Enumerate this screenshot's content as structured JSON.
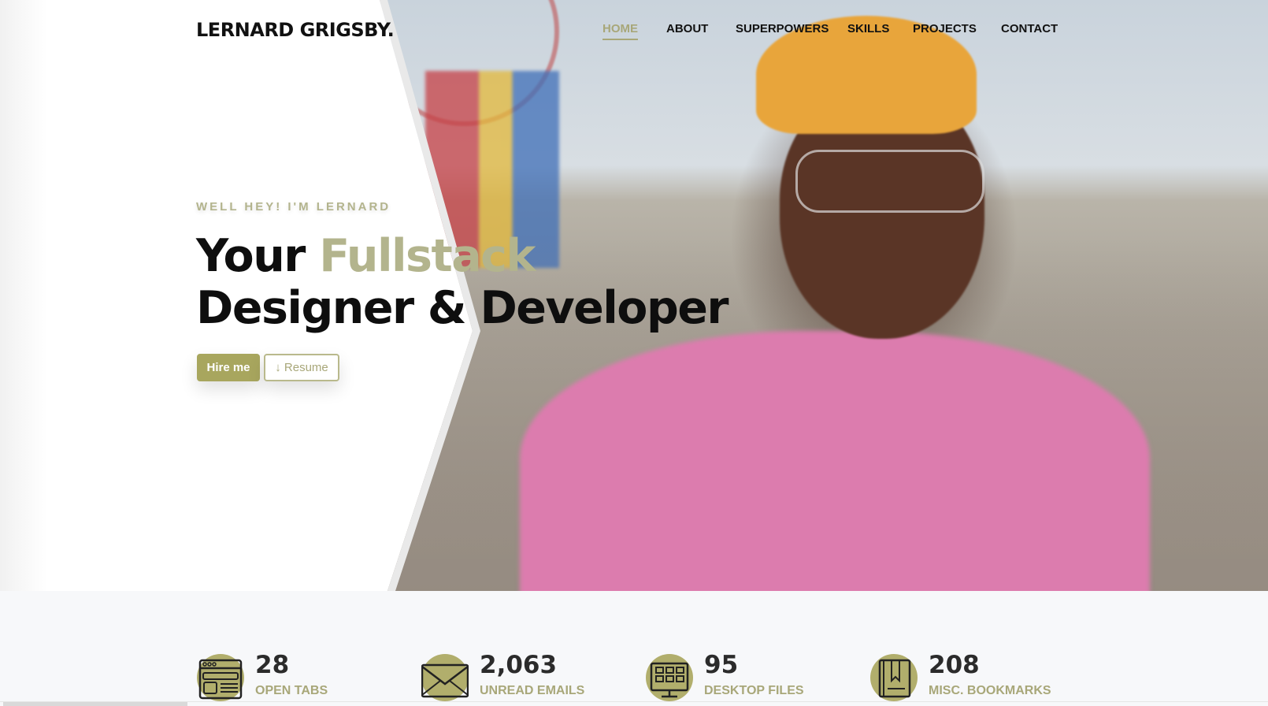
{
  "header": {
    "logo": "LERNARD GRIGSBY.",
    "nav": [
      {
        "label": "HOME",
        "active": true
      },
      {
        "label": "ABOUT",
        "active": false
      },
      {
        "label": "SUPERPOWERS",
        "active": false
      },
      {
        "label": "SKILLS",
        "active": false
      },
      {
        "label": "PROJECTS",
        "active": false
      },
      {
        "label": "CONTACT",
        "active": false
      }
    ]
  },
  "hero": {
    "greeting": "WELL HEY! I'M LERNARD",
    "headline_word1": "Your",
    "headline_accent": "Fullstack",
    "headline_line2": "Designer & Developer",
    "hire_button": "Hire me",
    "resume_button": "↓ Resume"
  },
  "stats": [
    {
      "icon": "browser-tabs-icon",
      "value": "28",
      "label": "OPEN TABS"
    },
    {
      "icon": "envelope-icon",
      "value": "2,063",
      "label": "UNREAD EMAILS"
    },
    {
      "icon": "desktop-monitor-icon",
      "value": "95",
      "label": "DESKTOP FILES"
    },
    {
      "icon": "bookmark-book-icon",
      "value": "208",
      "label": "MISC. BOOKMARKS"
    }
  ],
  "colors": {
    "accent": "#a8a779",
    "accent_button": "#a8a65e",
    "text_dark": "#111111",
    "stats_background": "#f7f8fa"
  }
}
